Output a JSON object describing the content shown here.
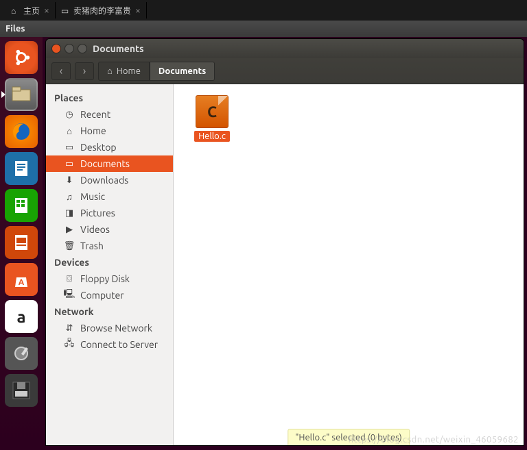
{
  "tabs": [
    {
      "label": "主页"
    },
    {
      "label": "卖猪肉的李富贵"
    }
  ],
  "menu": {
    "files": "Files"
  },
  "window": {
    "title": "Documents"
  },
  "toolbar": {
    "back": "‹",
    "forward": "›",
    "path": [
      {
        "label": "Home"
      },
      {
        "label": "Documents"
      }
    ]
  },
  "sidebar": {
    "sections": [
      {
        "heading": "Places",
        "items": [
          {
            "label": "Recent",
            "icon": "◷"
          },
          {
            "label": "Home",
            "icon": "⌂"
          },
          {
            "label": "Desktop",
            "icon": "▭"
          },
          {
            "label": "Documents",
            "icon": "▭",
            "selected": true
          },
          {
            "label": "Downloads",
            "icon": "⬇"
          },
          {
            "label": "Music",
            "icon": "♫"
          },
          {
            "label": "Pictures",
            "icon": "◨"
          },
          {
            "label": "Videos",
            "icon": "▶"
          },
          {
            "label": "Trash",
            "icon": "🗑"
          }
        ]
      },
      {
        "heading": "Devices",
        "items": [
          {
            "label": "Floppy Disk",
            "icon": "⌼"
          },
          {
            "label": "Computer",
            "icon": "🖳"
          }
        ]
      },
      {
        "heading": "Network",
        "items": [
          {
            "label": "Browse Network",
            "icon": "⇵"
          },
          {
            "label": "Connect to Server",
            "icon": "🖧"
          }
        ]
      }
    ]
  },
  "content": {
    "files": [
      {
        "name": "Hello.c",
        "thumb_letter": "C"
      }
    ]
  },
  "status": "\"Hello.c\" selected  (0 bytes)",
  "watermark": "https://blog.csdn.net/weixin_46059682"
}
